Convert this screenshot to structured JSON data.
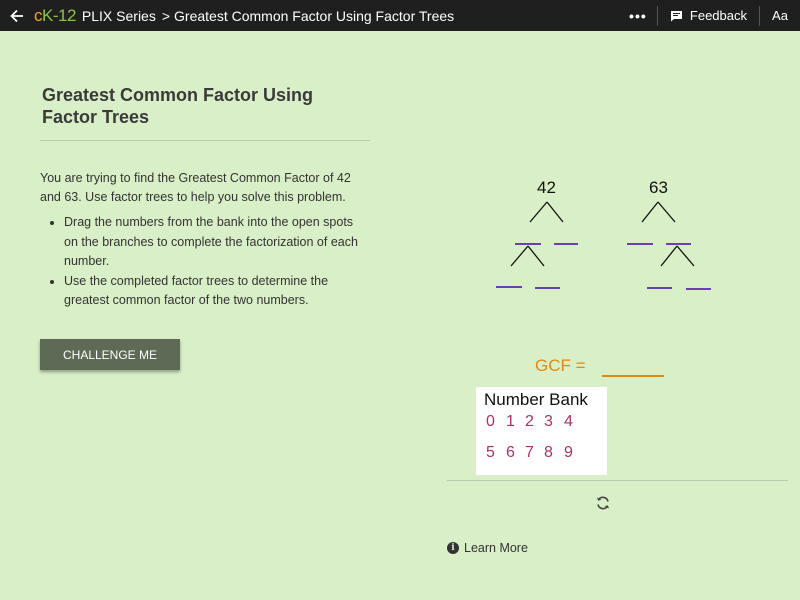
{
  "topbar": {
    "logo": {
      "c": "c",
      "k": "K",
      "num": "-12"
    },
    "series": "PLIX Series",
    "separator": ">",
    "page_title": "Greatest Common Factor Using Factor Trees",
    "more": "•••",
    "feedback_label": "Feedback",
    "font_button": "Aa"
  },
  "content": {
    "title": "Greatest Common Factor Using Factor Trees",
    "intro": "You are trying to find the Greatest Common Factor of 42 and 63. Use factor trees to help you solve this problem.",
    "instructions": [
      "Drag the numbers from the bank into the open spots on the branches to complete the factorization of each number.",
      "Use the completed factor trees to determine the greatest common factor of the two numbers."
    ],
    "challenge_label": "CHALLENGE ME"
  },
  "simulation": {
    "tree_left_root": "42",
    "tree_right_root": "63",
    "gcf_label": "GCF =",
    "bank_title": "Number Bank",
    "bank_row1": [
      "0",
      "1",
      "2",
      "3",
      "4"
    ],
    "bank_row2": [
      "5",
      "6",
      "7",
      "8",
      "9"
    ]
  },
  "footer": {
    "learn_more": "Learn More"
  },
  "colors": {
    "background": "#d9efc7",
    "topbar": "#1f1f1f",
    "blank_line": "#6a3fb3",
    "gcf": "#e08a12",
    "digit": "#b0306a",
    "button": "#5d6a55"
  }
}
